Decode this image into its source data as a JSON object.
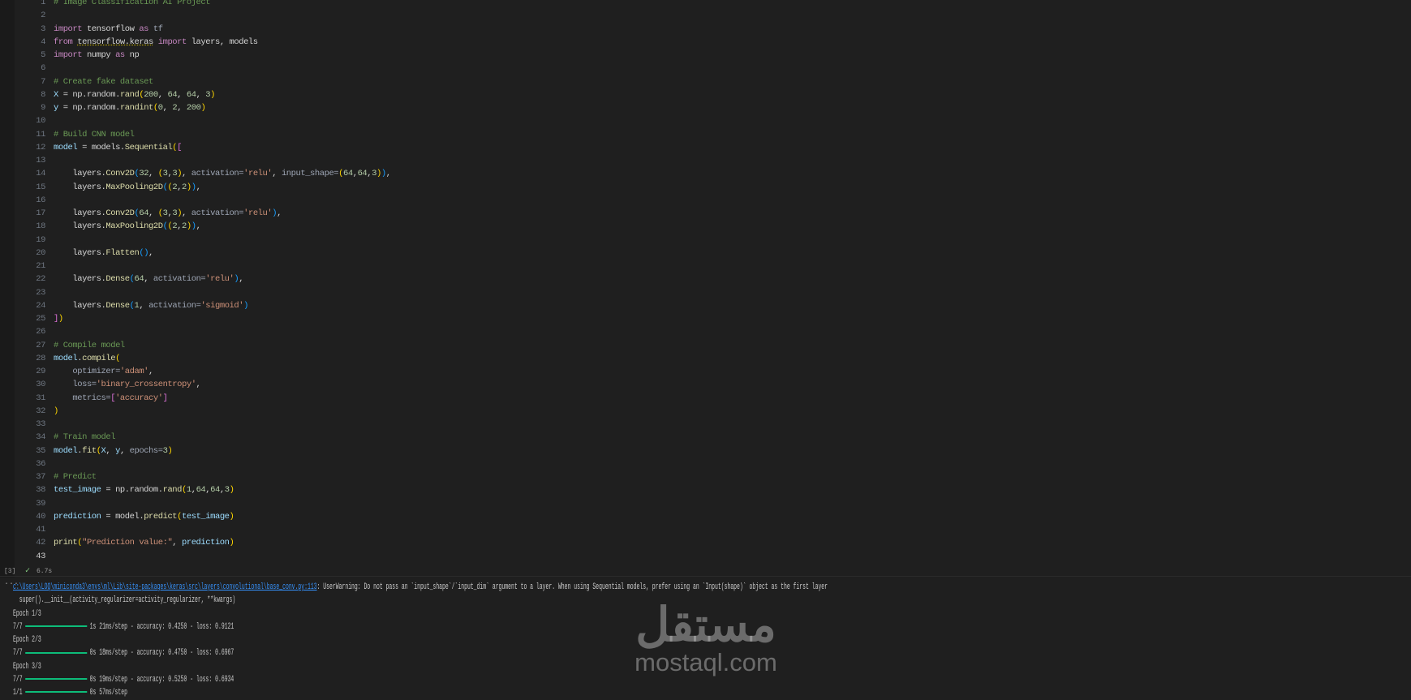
{
  "editor": {
    "current_line": 43,
    "lines": [
      [
        [
          "# Image Classification AI Project",
          "c"
        ]
      ],
      [],
      [
        [
          "import",
          "k"
        ],
        [
          " tensorflow ",
          "p"
        ],
        [
          "as",
          "k"
        ],
        [
          " tf",
          "g"
        ]
      ],
      [
        [
          "from",
          "k"
        ],
        [
          " ",
          "p"
        ],
        [
          "tensorflow.keras",
          "p ul"
        ],
        [
          " ",
          "p"
        ],
        [
          "import",
          "k"
        ],
        [
          " layers, models",
          "p"
        ]
      ],
      [
        [
          "import",
          "k"
        ],
        [
          " numpy ",
          "p"
        ],
        [
          "as",
          "k"
        ],
        [
          " np",
          "p"
        ]
      ],
      [],
      [
        [
          "# Create fake dataset",
          "c"
        ]
      ],
      [
        [
          "X",
          "v"
        ],
        [
          " = np.random.",
          "p"
        ],
        [
          "rand",
          "f"
        ],
        [
          "(",
          "b1"
        ],
        [
          "200",
          "n"
        ],
        [
          ", ",
          "p"
        ],
        [
          "64",
          "n"
        ],
        [
          ", ",
          "p"
        ],
        [
          "64",
          "n"
        ],
        [
          ", ",
          "p"
        ],
        [
          "3",
          "n"
        ],
        [
          ")",
          "b1"
        ]
      ],
      [
        [
          "y",
          "v"
        ],
        [
          " = np.random.",
          "p"
        ],
        [
          "randint",
          "f"
        ],
        [
          "(",
          "b1"
        ],
        [
          "0",
          "n"
        ],
        [
          ", ",
          "p"
        ],
        [
          "2",
          "n"
        ],
        [
          ", ",
          "p"
        ],
        [
          "200",
          "n"
        ],
        [
          ")",
          "b1"
        ]
      ],
      [],
      [
        [
          "# Build CNN model",
          "c"
        ]
      ],
      [
        [
          "model",
          "v"
        ],
        [
          " = models.",
          "p"
        ],
        [
          "Sequential",
          "f"
        ],
        [
          "(",
          "b1"
        ],
        [
          "[",
          "b2"
        ]
      ],
      [],
      [
        [
          "    layers.",
          "p"
        ],
        [
          "Conv2D",
          "f"
        ],
        [
          "(",
          "b3"
        ],
        [
          "32",
          "n"
        ],
        [
          ", ",
          "p"
        ],
        [
          "(",
          "b1"
        ],
        [
          "3",
          "n"
        ],
        [
          ",",
          "p"
        ],
        [
          "3",
          "n"
        ],
        [
          ")",
          "b1"
        ],
        [
          ", ",
          "p"
        ],
        [
          "activation=",
          "g"
        ],
        [
          "'relu'",
          "s"
        ],
        [
          ", ",
          "p"
        ],
        [
          "input_shape=",
          "g"
        ],
        [
          "(",
          "b1"
        ],
        [
          "64",
          "n"
        ],
        [
          ",",
          "p"
        ],
        [
          "64",
          "n"
        ],
        [
          ",",
          "p"
        ],
        [
          "3",
          "n"
        ],
        [
          ")",
          "b1"
        ],
        [
          ")",
          "b3"
        ],
        [
          ",",
          "p"
        ]
      ],
      [
        [
          "    layers.",
          "p"
        ],
        [
          "MaxPooling2D",
          "f"
        ],
        [
          "(",
          "b3"
        ],
        [
          "(",
          "b1"
        ],
        [
          "2",
          "n"
        ],
        [
          ",",
          "p"
        ],
        [
          "2",
          "n"
        ],
        [
          ")",
          "b1"
        ],
        [
          ")",
          "b3"
        ],
        [
          ",",
          "p"
        ]
      ],
      [],
      [
        [
          "    layers.",
          "p"
        ],
        [
          "Conv2D",
          "f"
        ],
        [
          "(",
          "b3"
        ],
        [
          "64",
          "n"
        ],
        [
          ", ",
          "p"
        ],
        [
          "(",
          "b1"
        ],
        [
          "3",
          "n"
        ],
        [
          ",",
          "p"
        ],
        [
          "3",
          "n"
        ],
        [
          ")",
          "b1"
        ],
        [
          ", ",
          "p"
        ],
        [
          "activation=",
          "g"
        ],
        [
          "'relu'",
          "s"
        ],
        [
          ")",
          "b3"
        ],
        [
          ",",
          "p"
        ]
      ],
      [
        [
          "    layers.",
          "p"
        ],
        [
          "MaxPooling2D",
          "f"
        ],
        [
          "(",
          "b3"
        ],
        [
          "(",
          "b1"
        ],
        [
          "2",
          "n"
        ],
        [
          ",",
          "p"
        ],
        [
          "2",
          "n"
        ],
        [
          ")",
          "b1"
        ],
        [
          ")",
          "b3"
        ],
        [
          ",",
          "p"
        ]
      ],
      [],
      [
        [
          "    layers.",
          "p"
        ],
        [
          "Flatten",
          "f"
        ],
        [
          "()",
          "b3"
        ],
        [
          ",",
          "p"
        ]
      ],
      [],
      [
        [
          "    layers.",
          "p"
        ],
        [
          "Dense",
          "f"
        ],
        [
          "(",
          "b3"
        ],
        [
          "64",
          "n"
        ],
        [
          ", ",
          "p"
        ],
        [
          "activation=",
          "g"
        ],
        [
          "'relu'",
          "s"
        ],
        [
          ")",
          "b3"
        ],
        [
          ",",
          "p"
        ]
      ],
      [],
      [
        [
          "    layers.",
          "p"
        ],
        [
          "Dense",
          "f"
        ],
        [
          "(",
          "b3"
        ],
        [
          "1",
          "n"
        ],
        [
          ", ",
          "p"
        ],
        [
          "activation=",
          "g"
        ],
        [
          "'sigmoid'",
          "s"
        ],
        [
          ")",
          "b3"
        ]
      ],
      [
        [
          "]",
          "b2"
        ],
        [
          ")",
          "b1"
        ]
      ],
      [],
      [
        [
          "# Compile model",
          "c"
        ]
      ],
      [
        [
          "model",
          "v"
        ],
        [
          ".",
          "p"
        ],
        [
          "compile",
          "f"
        ],
        [
          "(",
          "b1"
        ]
      ],
      [
        [
          "    optimizer=",
          "g"
        ],
        [
          "'adam'",
          "s"
        ],
        [
          ",",
          "p"
        ]
      ],
      [
        [
          "    loss=",
          "g"
        ],
        [
          "'binary_crossentropy'",
          "s"
        ],
        [
          ",",
          "p"
        ]
      ],
      [
        [
          "    metrics=",
          "g"
        ],
        [
          "[",
          "b2"
        ],
        [
          "'accuracy'",
          "s"
        ],
        [
          "]",
          "b2"
        ]
      ],
      [
        [
          ")",
          "b1"
        ]
      ],
      [],
      [
        [
          "# Train model",
          "c"
        ]
      ],
      [
        [
          "model",
          "v"
        ],
        [
          ".",
          "p"
        ],
        [
          "fit",
          "f"
        ],
        [
          "(",
          "b1"
        ],
        [
          "X",
          "v"
        ],
        [
          ", ",
          "p"
        ],
        [
          "y",
          "v"
        ],
        [
          ", ",
          "p"
        ],
        [
          "epochs=",
          "g"
        ],
        [
          "3",
          "n"
        ],
        [
          ")",
          "b1"
        ]
      ],
      [],
      [
        [
          "# Predict",
          "c"
        ]
      ],
      [
        [
          "test_image",
          "v"
        ],
        [
          " = np.random.",
          "p"
        ],
        [
          "rand",
          "f"
        ],
        [
          "(",
          "b1"
        ],
        [
          "1",
          "n"
        ],
        [
          ",",
          "p"
        ],
        [
          "64",
          "n"
        ],
        [
          ",",
          "p"
        ],
        [
          "64",
          "n"
        ],
        [
          ",",
          "p"
        ],
        [
          "3",
          "n"
        ],
        [
          ")",
          "b1"
        ]
      ],
      [],
      [
        [
          "prediction",
          "v"
        ],
        [
          " = model.",
          "p"
        ],
        [
          "predict",
          "f"
        ],
        [
          "(",
          "b1"
        ],
        [
          "test_image",
          "v"
        ],
        [
          ")",
          "b1"
        ]
      ],
      [],
      [
        [
          "print",
          "f"
        ],
        [
          "(",
          "b1"
        ],
        [
          "\"Prediction value:\"",
          "s"
        ],
        [
          ", ",
          "p"
        ],
        [
          "prediction",
          "v"
        ],
        [
          ")",
          "b1"
        ]
      ],
      []
    ]
  },
  "cell_status": {
    "execution_count": "[3]",
    "check_icon": "✓",
    "duration": "6.7s"
  },
  "output": {
    "more_icon": "...",
    "warning_link": "c:\\Users\\LOQ\\miniconda3\\envs\\ml\\Lib\\site-packages\\keras\\src\\layers\\convolutional\\base_conv.py:113",
    "warning_text": ": UserWarning: Do not pass an `input_shape`/`input_dim` argument to a layer. When using Sequential models, prefer using an `Input(shape)` object as the first layer",
    "super_line": "  super().__init__(activity_regularizer=activity_regularizer, **kwargs)",
    "progress_color": "#0dbc79",
    "entries": [
      {
        "epoch": "Epoch 1/3",
        "steps": "7/7",
        "progress": 1.0,
        "stats": "1s 21ms/step - accuracy: 0.4250 - loss: 0.9121"
      },
      {
        "epoch": "Epoch 2/3",
        "steps": "7/7",
        "progress": 1.0,
        "stats": "0s 18ms/step - accuracy: 0.4750 - loss: 0.6967"
      },
      {
        "epoch": "Epoch 3/3",
        "steps": "7/7",
        "progress": 1.0,
        "stats": "0s 19ms/step - accuracy: 0.5250 - loss: 0.6934"
      },
      {
        "epoch": null,
        "steps": "1/1",
        "progress": 1.0,
        "stats": "0s 57ms/step"
      }
    ]
  },
  "watermark": {
    "arabic": "مستقل",
    "latin": "mostaql.com"
  }
}
